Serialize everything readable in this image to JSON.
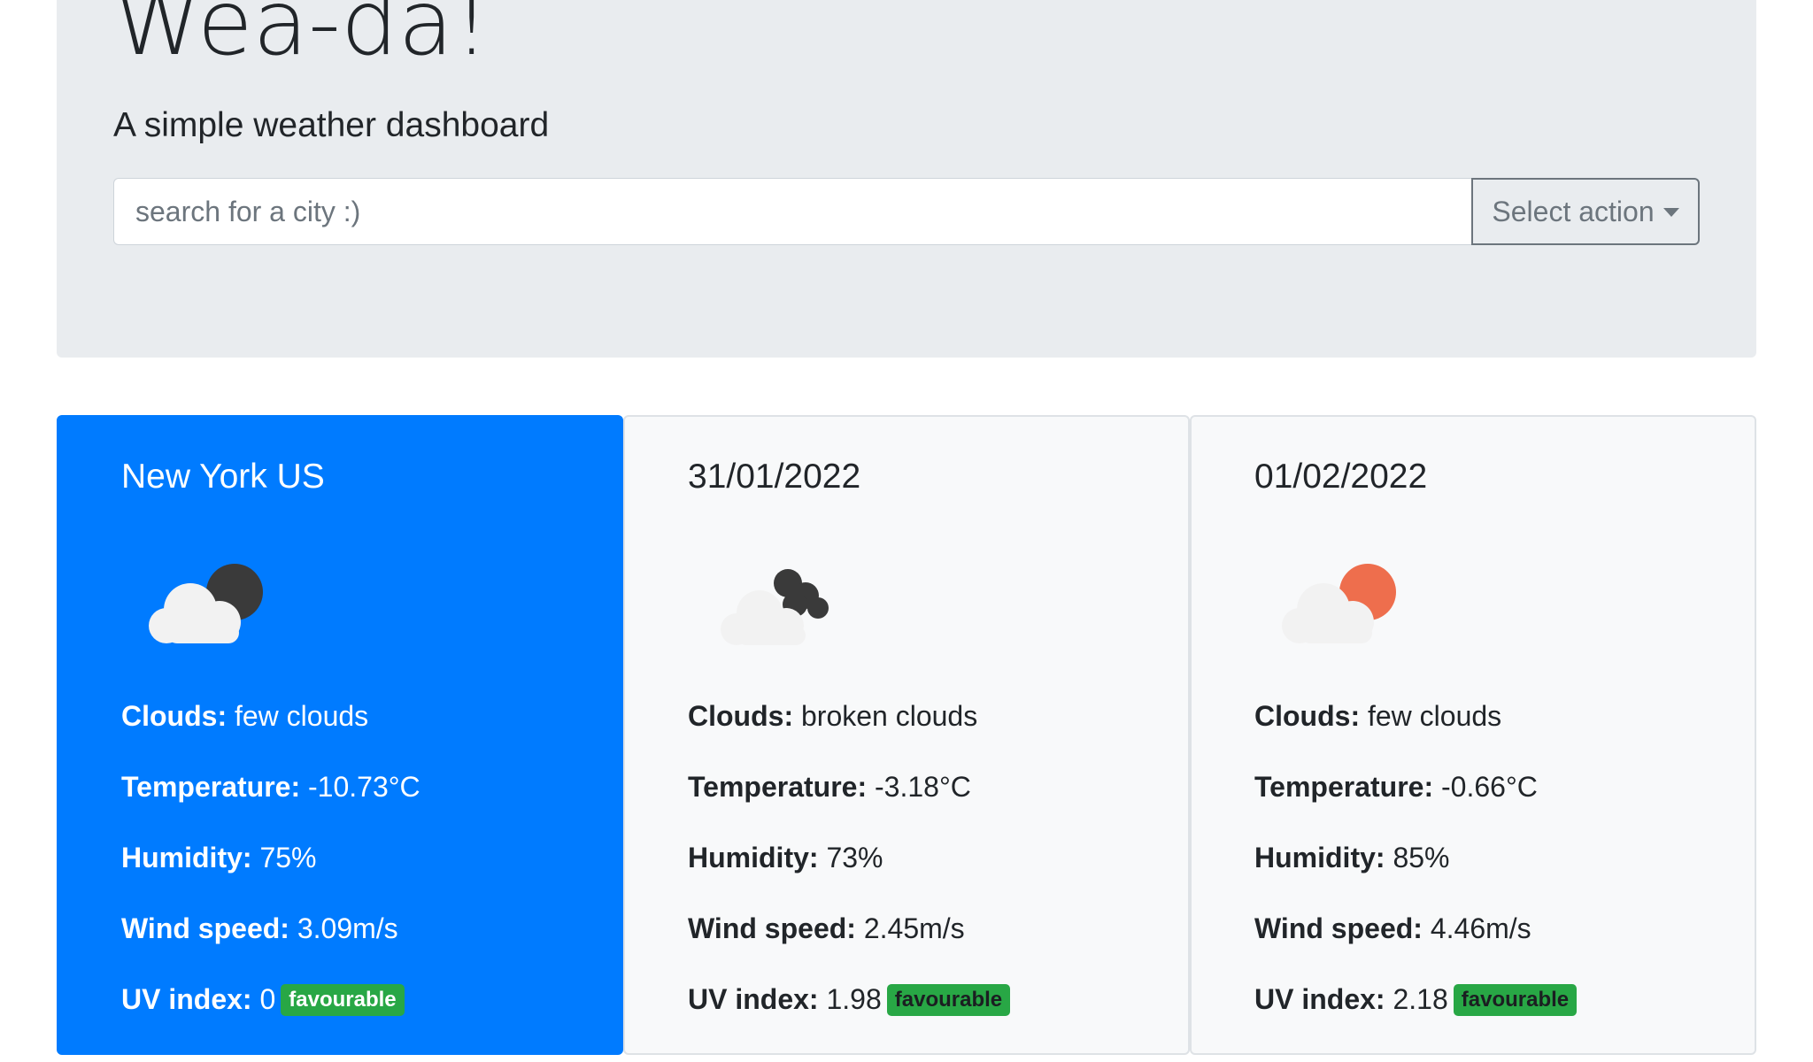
{
  "header": {
    "title": "Wea-da!",
    "subtitle": "A simple weather dashboard"
  },
  "search": {
    "placeholder": "search for a city :)",
    "value": "",
    "action_label": "Select action"
  },
  "cards": [
    {
      "title": "New York US",
      "icon": "few-clouds-night-icon",
      "labels": {
        "clouds": "Clouds:",
        "temperature": "Temperature:",
        "humidity": "Humidity:",
        "wind": "Wind speed:",
        "uv": "UV index:"
      },
      "clouds": "few clouds",
      "temperature": "-10.73°C",
      "humidity": "75%",
      "wind": "3.09m/s",
      "uv": "0",
      "uv_badge": "favourable"
    },
    {
      "title": "31/01/2022",
      "icon": "broken-clouds-icon",
      "labels": {
        "clouds": "Clouds:",
        "temperature": "Temperature:",
        "humidity": "Humidity:",
        "wind": "Wind speed:",
        "uv": "UV index:"
      },
      "clouds": "broken clouds",
      "temperature": "-3.18°C",
      "humidity": "73%",
      "wind": "2.45m/s",
      "uv": "1.98",
      "uv_badge": "favourable"
    },
    {
      "title": "01/02/2022",
      "icon": "few-clouds-day-icon",
      "labels": {
        "clouds": "Clouds:",
        "temperature": "Temperature:",
        "humidity": "Humidity:",
        "wind": "Wind speed:",
        "uv": "UV index:"
      },
      "clouds": "few clouds",
      "temperature": "-0.66°C",
      "humidity": "85%",
      "wind": "4.46m/s",
      "uv": "2.18",
      "uv_badge": "favourable"
    }
  ],
  "colors": {
    "primary": "#007bff",
    "jumbotron": "#e9ecef",
    "badge_success": "#28a745",
    "sun": "#ee6e4d",
    "moon": "#3a3a3a"
  }
}
